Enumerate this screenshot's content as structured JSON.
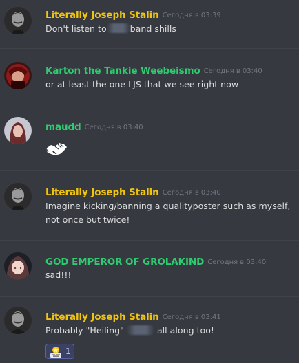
{
  "colors": {
    "background": "#36393f",
    "stalin_name": "#f1c40f",
    "green_name": "#2ecc71",
    "timestamp": "#72767d",
    "text": "#dcddde"
  },
  "messages": [
    {
      "author": "Literally Joseph Stalin",
      "timestamp": "Сегодня в 03:39",
      "text_before": "Don't listen to",
      "text_after": "band shills"
    },
    {
      "author": "Karton the Tankie Weebeismo",
      "timestamp": "Сегодня в 03:40",
      "text": "or at least the one LJS that we see right now"
    },
    {
      "author": "maudd",
      "timestamp": "Сегодня в 03:40",
      "emoji": "handshake-emoji"
    },
    {
      "author": "Literally Joseph Stalin",
      "timestamp": "Сегодня в 03:40",
      "text": "Imagine kicking/banning a qualityposter such as myself, not once but twice!"
    },
    {
      "author": "GOD EMPEROR OF GROLAKIND",
      "timestamp": "Сегодня в 03:40",
      "text": "sad!!!"
    },
    {
      "author": "Literally Joseph Stalin",
      "timestamp": "Сегодня в 03:41",
      "text_before": "Probably \"Heiling\"",
      "text_after": "all along too!",
      "reaction": {
        "emoji": "you-tried-emoji",
        "count": "1"
      }
    }
  ]
}
